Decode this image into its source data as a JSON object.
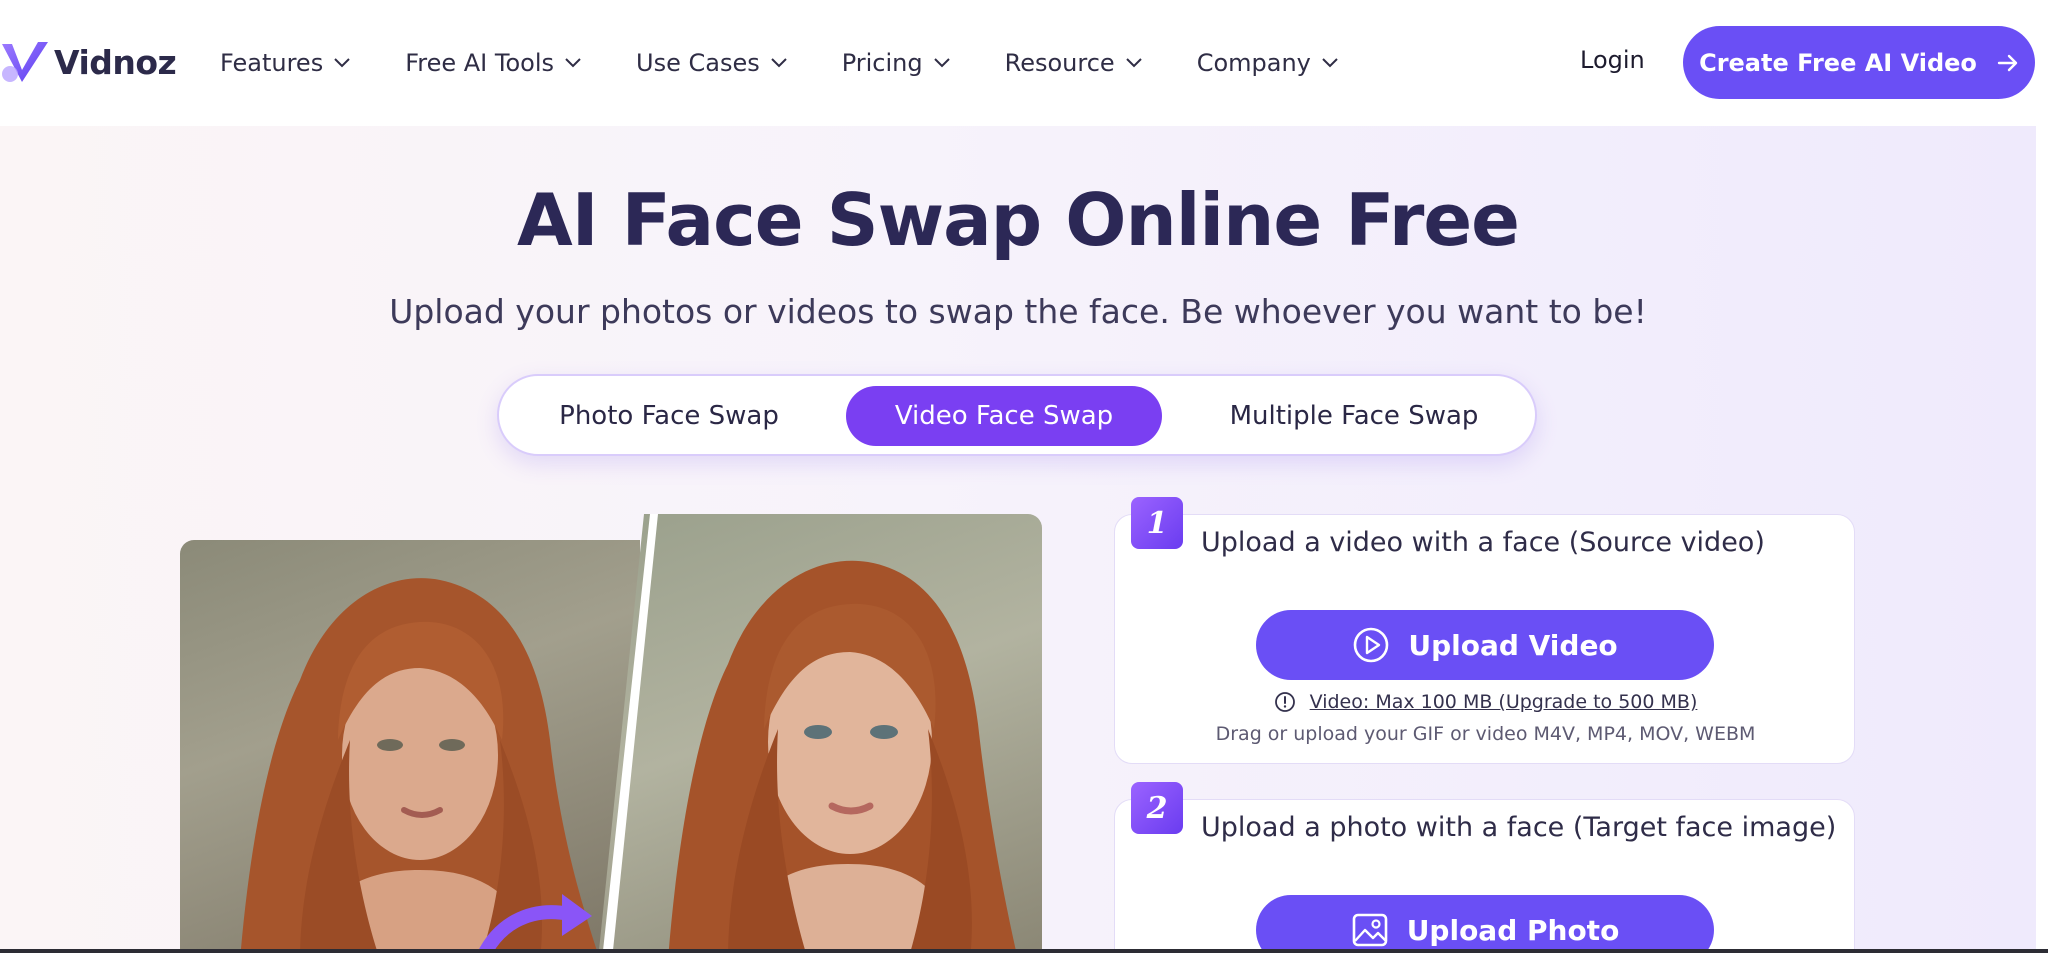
{
  "brand": {
    "logo_text": "Vidnoz",
    "accent": "#6a4ff5",
    "active_tab_color": "#7a3ff2",
    "title_color": "#2c2856"
  },
  "nav": {
    "items": [
      {
        "label": "Features",
        "icon": "chevron-down-icon"
      },
      {
        "label": "Free AI Tools",
        "icon": "chevron-down-icon"
      },
      {
        "label": "Use Cases",
        "icon": "chevron-down-icon"
      },
      {
        "label": "Pricing",
        "icon": "chevron-down-icon"
      },
      {
        "label": "Resource",
        "icon": "chevron-down-icon"
      },
      {
        "label": "Company",
        "icon": "chevron-down-icon"
      }
    ],
    "login": "Login",
    "cta": "Create Free AI Video",
    "cta_icon": "arrow-right-icon"
  },
  "hero": {
    "title": "AI Face Swap Online Free",
    "subtitle": "Upload your photos or videos to swap the face. Be whoever you want to be!",
    "tabs": [
      {
        "label": "Photo Face Swap",
        "active": false
      },
      {
        "label": "Video Face Swap",
        "active": true
      },
      {
        "label": "Multiple Face Swap",
        "active": false
      }
    ]
  },
  "steps": [
    {
      "number": "1",
      "title": "Upload a video with a face (Source video)",
      "button": "Upload Video",
      "button_icon": "play-circle-icon",
      "limit_icon": "info-icon",
      "limit": "Video: Max 100 MB (Upgrade to 500 MB)",
      "formats": "Drag or upload your GIF or video M4V, MP4, MOV, WEBM"
    },
    {
      "number": "2",
      "title": "Upload a photo with a face (Target face image)",
      "button": "Upload Photo",
      "button_icon": "image-icon"
    }
  ]
}
